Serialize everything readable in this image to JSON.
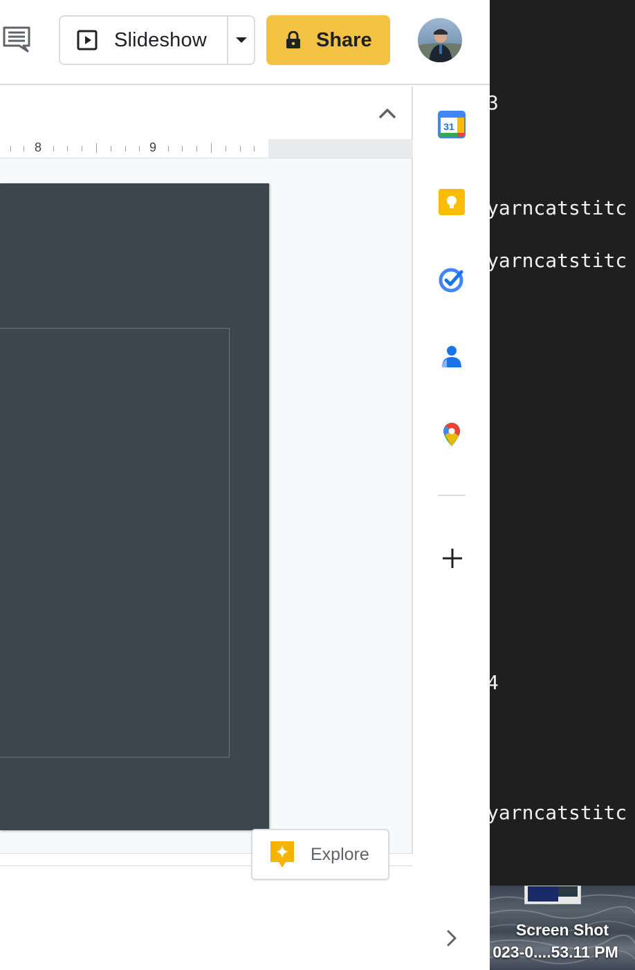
{
  "toolbar": {
    "comment_icon": "comment-icon",
    "slideshow_label": "Slideshow",
    "share_label": "Share",
    "share_icon": "lock-icon"
  },
  "ruler": {
    "numbers": [
      "8",
      "9"
    ]
  },
  "side_panel": {
    "apps": [
      {
        "name": "calendar",
        "label": "31",
        "color": "#4285f4"
      },
      {
        "name": "keep",
        "color": "#fbbc04"
      },
      {
        "name": "tasks",
        "color": "#1a73e8"
      },
      {
        "name": "contacts",
        "color": "#1a73e8"
      },
      {
        "name": "maps",
        "color": "#34a853"
      }
    ]
  },
  "explore": {
    "label": "Explore"
  },
  "terminal": {
    "lines": [
      "3",
      "yarncatstitc",
      "yarncatstitc",
      "4",
      "yarncatstitc"
    ]
  },
  "desktop": {
    "file_name_line1": "Screen Shot",
    "file_name_line2": "023-0....53.11 PM"
  },
  "colors": {
    "share_bg": "#f4c242",
    "slide_bg": "#3c474d",
    "terminal_bg": "#1f1f1f"
  }
}
